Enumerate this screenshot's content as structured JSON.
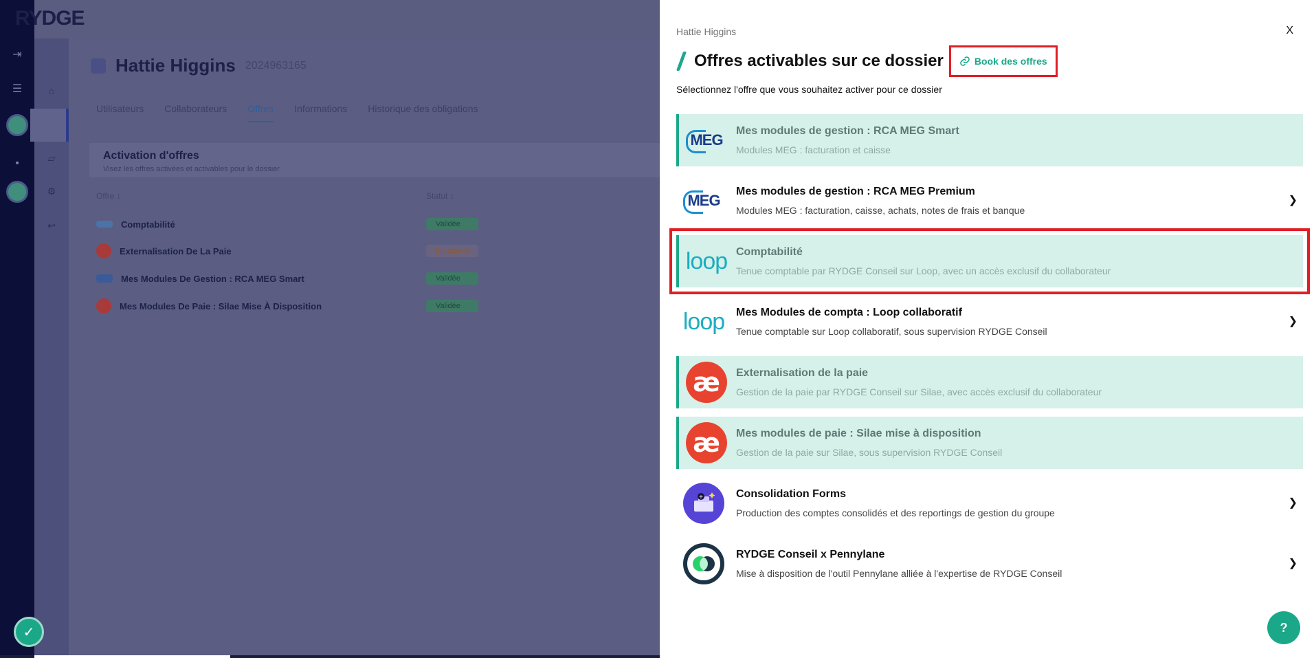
{
  "background": {
    "logo": "RYDGE",
    "client_name": "Hattie Higgins",
    "client_code": "2024963165",
    "tabs": [
      "Utilisateurs",
      "Collaborateurs",
      "Offres",
      "Informations",
      "Historique des obligations"
    ],
    "card_title": "Activation d'offres",
    "card_subtitle": "Visez les offres activées et activables pour le dossier",
    "col_offer": "Offre ↕",
    "col_status": "Statut ↕",
    "rows": [
      {
        "label": "Comptabilité",
        "status": "Validée"
      },
      {
        "label": "Externalisation De La Paie",
        "status": "En attente"
      },
      {
        "label": "Mes Modules De Gestion : RCA MEG Smart",
        "status": "Validée"
      },
      {
        "label": "Mes Modules De Paie : Silae Mise À Disposition",
        "status": "Validée"
      }
    ]
  },
  "panel": {
    "user": "Hattie Higgins",
    "close": "X",
    "title": "Offres activables sur ce dossier",
    "book_link": "Book des offres",
    "subtitle": "Sélectionnez l'offre que vous souhaitez activer pour ce dossier",
    "offers": [
      {
        "title": "Mes modules de gestion : RCA MEG Smart",
        "desc": "Modules MEG : facturation et caisse",
        "logo": "meg-logo",
        "logo_text": "MEG"
      },
      {
        "title": "Mes modules de gestion : RCA MEG Premium",
        "desc": "Modules MEG : facturation, caisse, achats, notes de frais et banque",
        "logo": "meg-logo",
        "logo_text": "MEG"
      },
      {
        "title": "Comptabilité",
        "desc": "Tenue comptable par RYDGE Conseil sur Loop, avec un accès exclusif du collaborateur",
        "logo": "loop-logo",
        "logo_text": "loop"
      },
      {
        "title": "Mes Modules de compta : Loop collaboratif",
        "desc": "Tenue comptable sur Loop collaboratif, sous supervision RYDGE Conseil",
        "logo": "loop-logo",
        "logo_text": "loop"
      },
      {
        "title": "Externalisation de la paie",
        "desc": "Gestion de la paie par RYDGE Conseil sur Silae, avec accès exclusif du collaborateur",
        "logo": "silae-logo",
        "logo_text": "æ"
      },
      {
        "title": "Mes modules de paie : Silae mise à disposition",
        "desc": "Gestion de la paie sur Silae, sous supervision RYDGE Conseil",
        "logo": "silae-logo",
        "logo_text": "æ"
      },
      {
        "title": "Consolidation Forms",
        "desc": "Production des comptes consolidés et des reportings de gestion du groupe",
        "logo": "consolidation-forms-logo"
      },
      {
        "title": "RYDGE Conseil x Pennylane",
        "desc": "Mise à disposition de l'outil Pennylane alliée à l'expertise de RYDGE Conseil",
        "logo": "pennylane-logo"
      }
    ],
    "chevron": "❯",
    "help": "?"
  },
  "colors": {
    "accent": "#1aa889",
    "highlight_frame": "#e01f25",
    "active_row_bg": "#d6f0ea"
  }
}
